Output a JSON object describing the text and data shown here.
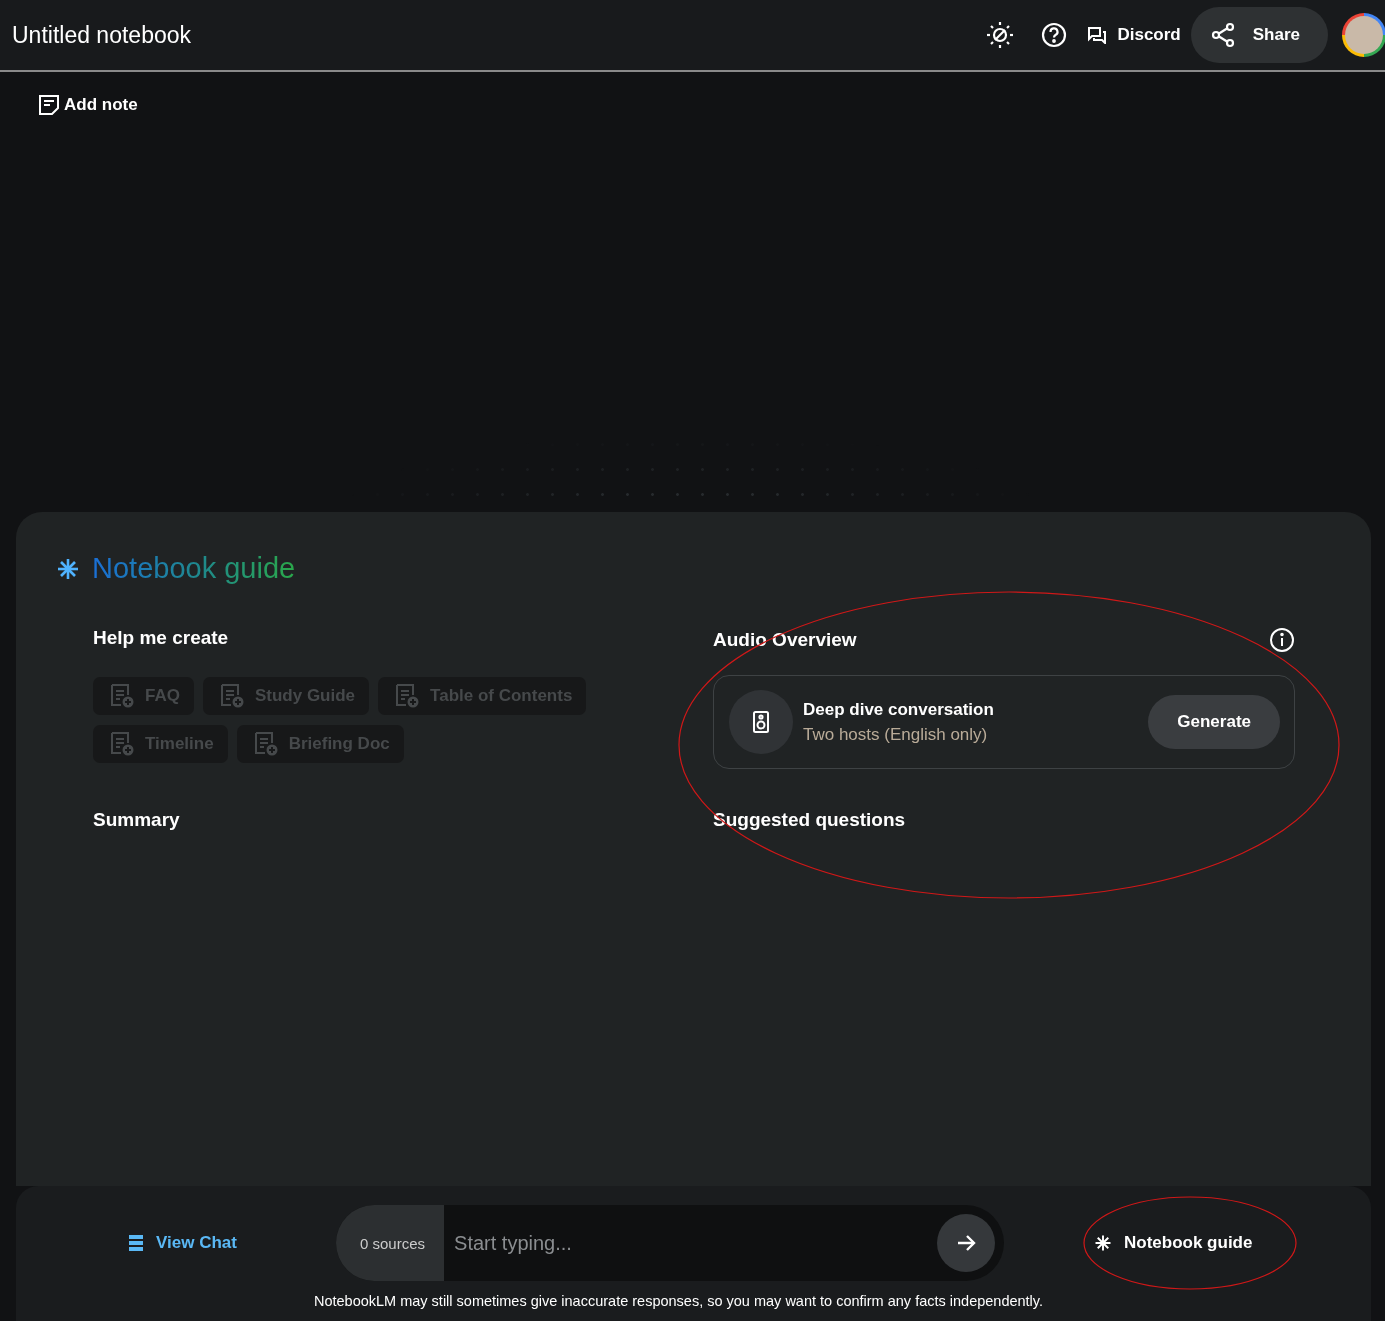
{
  "header": {
    "title": "Untitled notebook",
    "discord_label": "Discord",
    "share_label": "Share"
  },
  "notes": {
    "add_note_label": "Add note"
  },
  "guide": {
    "title": "Notebook guide",
    "help_heading": "Help me create",
    "chips": [
      {
        "label": "FAQ",
        "disabled": true
      },
      {
        "label": "Study Guide",
        "disabled": true
      },
      {
        "label": "Table of Contents",
        "disabled": true
      },
      {
        "label": "Timeline",
        "disabled": true
      },
      {
        "label": "Briefing Doc",
        "disabled": true
      }
    ],
    "summary_heading": "Summary",
    "audio": {
      "heading": "Audio Overview",
      "card_title": "Deep dive conversation",
      "card_subtitle": "Two hosts (English only)",
      "button": "Generate"
    },
    "suggested_heading": "Suggested questions"
  },
  "footer": {
    "view_chat": "View Chat",
    "sources": "0 sources",
    "input": {
      "placeholder": "Start typing..."
    },
    "guide_button": "Notebook guide",
    "disclaimer": "NotebookLM may still sometimes give inaccurate responses, so you may want to confirm any facts independently."
  },
  "annotations": [
    {
      "kind": "ellipse"
    },
    {
      "kind": "ellipse"
    }
  ]
}
